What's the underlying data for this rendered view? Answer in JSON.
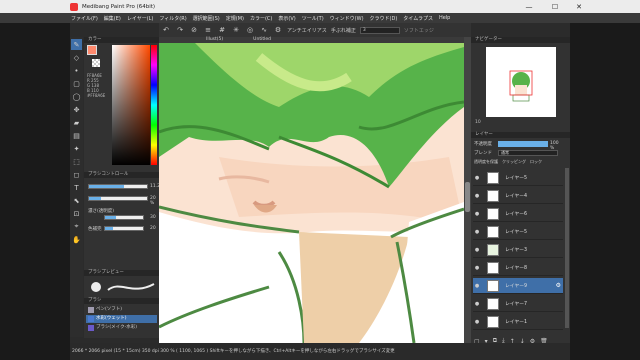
{
  "window": {
    "title": "Medibang Paint Pro (64bit)",
    "controls": [
      "—",
      "☐",
      "✕"
    ]
  },
  "menu": [
    "ファイル(F)",
    "編集(E)",
    "レイヤー(L)",
    "フィルタ(R)",
    "選択範囲(S)",
    "定規(M)",
    "カラー(C)",
    "表示(V)",
    "ツール(T)",
    "ウィンドウ(W)",
    "クラウド(D)",
    "タイムラプス",
    "Help"
  ],
  "toolbar": {
    "antialias_label": "アンチエイリアス",
    "correction_label": "手ぶれ補正",
    "correction_value": "3",
    "soft_edge": "ソフトエッジ"
  },
  "canvas_tabs": [
    "Illust(5)",
    "Untitled"
  ],
  "tools": [
    "pen-icon",
    "eraser-icon",
    "dot-icon",
    "rect-select-icon",
    "lasso-icon",
    "move-icon",
    "fill-icon",
    "gradient-icon",
    "text-icon",
    "hand-icon"
  ],
  "color_panel": {
    "title": "カラー",
    "fg": "#ff8a6e",
    "hex_lines": [
      "FF8A6E",
      "R 255",
      "G 138",
      "B 110",
      "#FF8A6E"
    ]
  },
  "brush_control": {
    "title": "ブラシコントロール",
    "size_label": "",
    "size_value": "11.2",
    "size_fraction": 0.6,
    "opacity_value": "20 %",
    "opacity_fraction": 0.2,
    "smooth_label": "濃さ(透明度)",
    "smooth_value": "30",
    "smooth_fraction": 0.3,
    "fill_label": "色補完",
    "fill_value": "20",
    "fill_fraction": 0.2
  },
  "brush_preview": {
    "title": "ブラシプレビュー"
  },
  "brush_list": {
    "title": "ブラシ",
    "items": [
      {
        "label": "ペン(ソフト)",
        "color": "#a09cb0",
        "selected": false
      },
      {
        "label": "水彩(ウェット)",
        "color": "#4a7ad0",
        "selected": true
      },
      {
        "label": "ブラシ(メイク-水彩)",
        "color": "#6a5ac8",
        "selected": false
      }
    ]
  },
  "navigator": {
    "title": "ナビゲーター",
    "zoom": "10"
  },
  "layers": {
    "title": "レイヤー",
    "opacity_label": "不透明度",
    "opacity_value": "100 %",
    "blend_label": "ブレンド",
    "blend_value": "通常",
    "protect_label": "透明度を保護",
    "clipping_label": "クリッピング",
    "lock_label": "ロック",
    "rows": [
      {
        "name": "レイヤー5",
        "selected": false,
        "thumb": "#fff"
      },
      {
        "name": "レイヤー4",
        "selected": false,
        "thumb": "#fff"
      },
      {
        "name": "レイヤー6",
        "selected": false,
        "thumb": "#fff"
      },
      {
        "name": "レイヤー5",
        "selected": false,
        "thumb": "#fff"
      },
      {
        "name": "レイヤー3",
        "selected": false,
        "thumb": "#e8f4e0"
      },
      {
        "name": "レイヤー8",
        "selected": false,
        "thumb": "#fff"
      },
      {
        "name": "レイヤー9",
        "selected": true,
        "thumb": "#fff"
      },
      {
        "name": "レイヤー7",
        "selected": false,
        "thumb": "#fff"
      },
      {
        "name": "レイヤー1",
        "selected": false,
        "thumb": "#fff"
      }
    ]
  },
  "status": "2066 * 2066 pixel  (15 * 15cm)  350 dpi   300 %   ( 1100, 1065 )   Shiftキーを押しながら下描き、Ctrl+Altキーを押しながら左右ドラッグでブラシサイズ変更"
}
